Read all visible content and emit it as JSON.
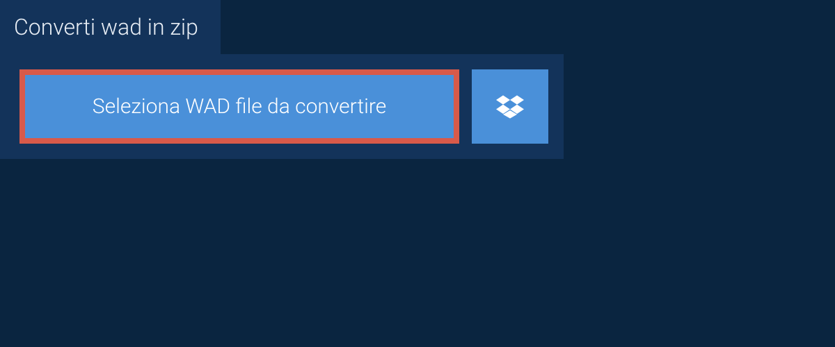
{
  "header": {
    "title": "Converti wad in zip"
  },
  "actions": {
    "select_file_label": "Seleziona WAD file da convertire"
  },
  "colors": {
    "background": "#0a2540",
    "panel": "#13335a",
    "button": "#4a90d9",
    "button_border": "#d85a4a",
    "text_light": "#ffffff"
  }
}
